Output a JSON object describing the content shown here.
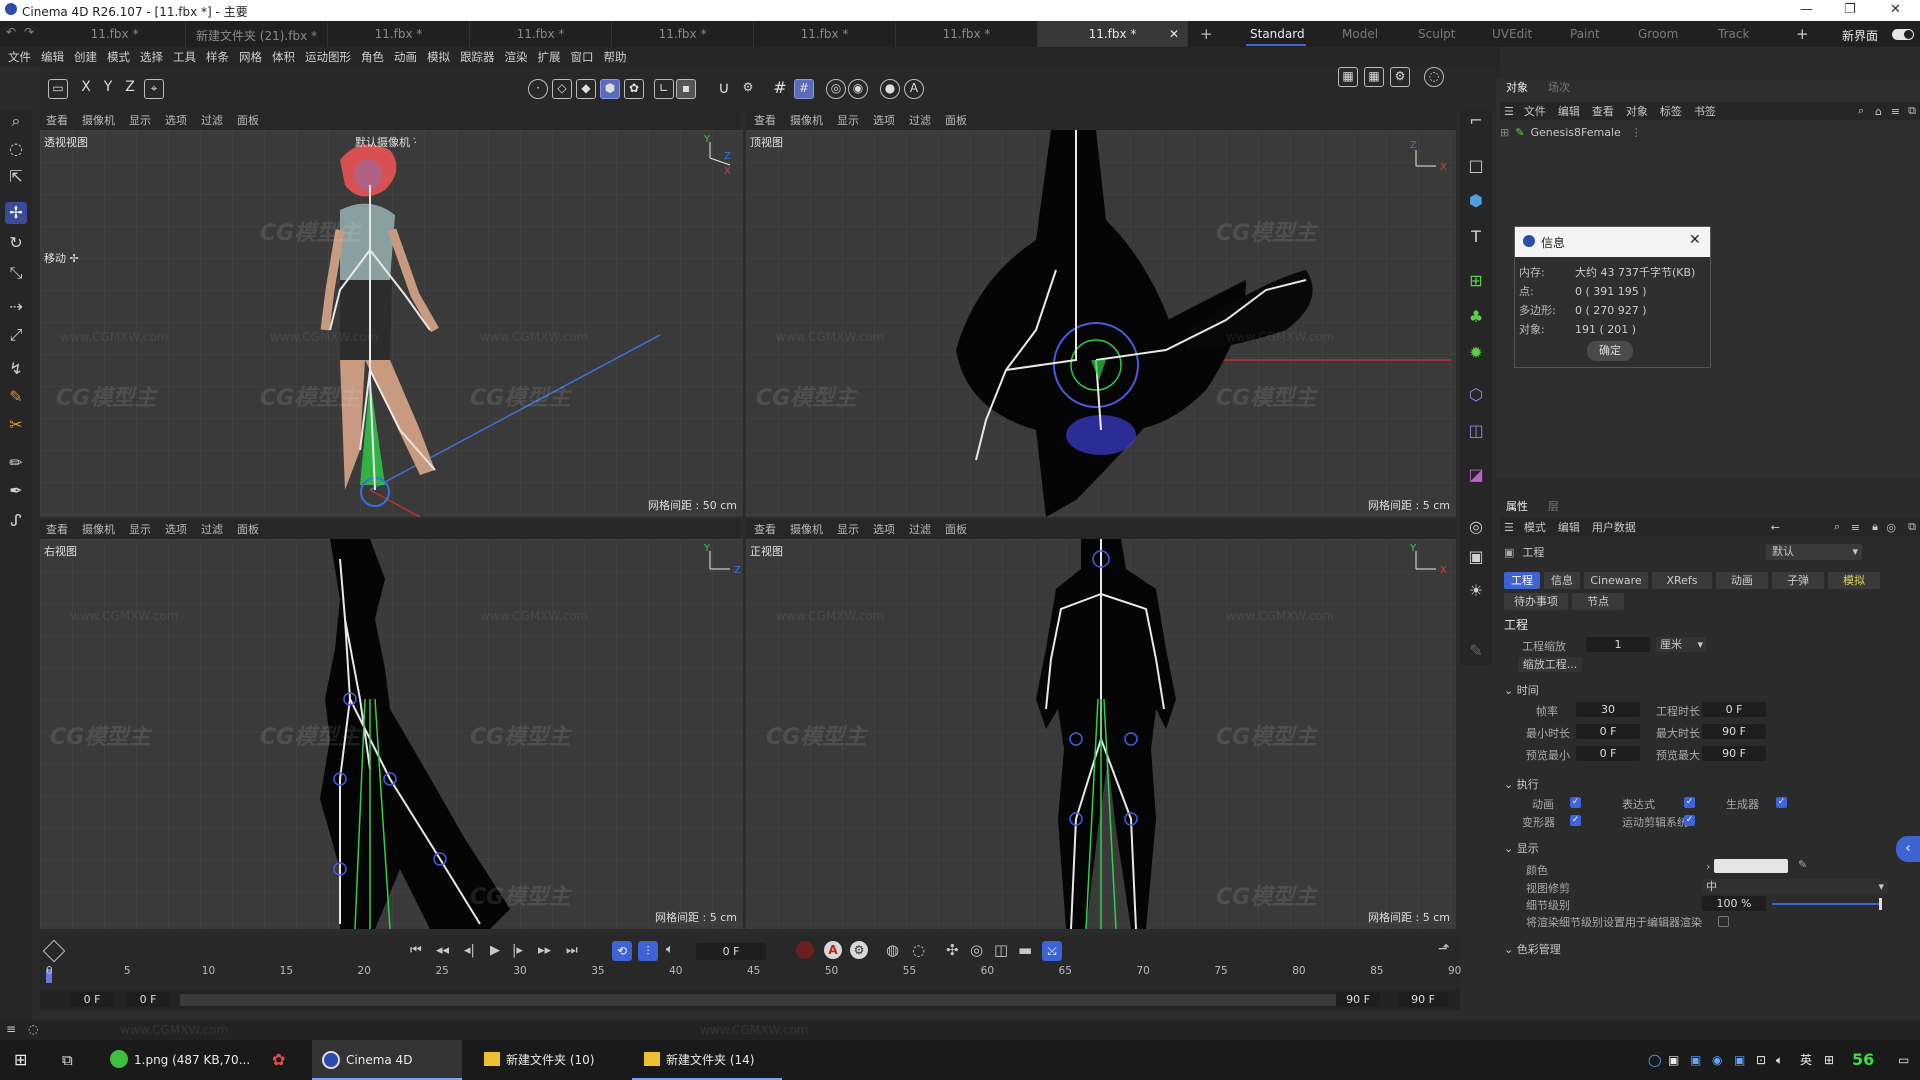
{
  "window": {
    "title": "Cinema 4D R26.107 - [11.fbx *] - 主要"
  },
  "file_tabs": [
    "11.fbx *",
    "新建文件夹 (21).fbx *",
    "11.fbx *",
    "11.fbx *",
    "11.fbx *",
    "11.fbx *",
    "11.fbx *",
    "11.fbx *"
  ],
  "layout_tabs": [
    "Standard",
    "Model",
    "Sculpt",
    "UVEdit",
    "Paint",
    "Groom",
    "Track"
  ],
  "new_layout": "新界面",
  "menu": [
    "文件",
    "编辑",
    "创建",
    "模式",
    "选择",
    "工具",
    "样条",
    "网格",
    "体积",
    "运动图形",
    "角色",
    "动画",
    "模拟",
    "跟踪器",
    "渲染",
    "扩展",
    "窗口",
    "帮助"
  ],
  "toolbar": {
    "x": "X",
    "y": "Y",
    "z": "Z"
  },
  "viewport_menu": [
    "查看",
    "摄像机",
    "显示",
    "选项",
    "过滤",
    "面板"
  ],
  "viewports": {
    "perspective": {
      "label": "透视视图",
      "camera": "默认摄像机 ·̇",
      "grid": "网格间距 : 50 cm",
      "move": "移动 ✢"
    },
    "top": {
      "label": "顶视图",
      "grid": "网格间距 : 5 cm"
    },
    "right": {
      "label": "右视图",
      "grid": "网格间距 : 5 cm"
    },
    "front": {
      "label": "正视图",
      "grid": "网格间距 : 5 cm"
    }
  },
  "watermark": {
    "text": "CG模型主",
    "url": "www.CGMXW.com"
  },
  "object_manager": {
    "tabs": [
      "对象",
      "场次"
    ],
    "menu": [
      "文件",
      "编辑",
      "查看",
      "对象",
      "标签",
      "书签"
    ],
    "object": "Genesis8Female"
  },
  "info_dialog": {
    "title": "信息",
    "rows": [
      {
        "label": "内存:",
        "value": "大约 43 737千字节(KB)"
      },
      {
        "label": "点:",
        "value": "0 ( 391 195 )"
      },
      {
        "label": "多边形:",
        "value": "0 ( 270 927 )"
      },
      {
        "label": "对象:",
        "value": "191 ( 201 )"
      }
    ],
    "ok": "确定"
  },
  "attributes": {
    "tabs": [
      "属性",
      "层"
    ],
    "menu": [
      "模式",
      "编辑",
      "用户数据"
    ],
    "section": "工程",
    "preset": "默认",
    "subtabs": [
      "工程",
      "信息",
      "Cineware",
      "XRefs",
      "动画",
      "子弹",
      "模拟"
    ],
    "subtabs2": [
      "待办事项",
      "节点"
    ],
    "heading": "工程",
    "scale_label": "工程缩放",
    "scale_value": "1",
    "scale_unit": "厘米",
    "scale_btn": "缩放工程...",
    "time_group": "时间",
    "fps_label": "帧率",
    "fps": "30",
    "proj_len_label": "工程时长",
    "proj_len": "0 F",
    "min_label": "最小时长",
    "min": "0 F",
    "max_label": "最大时长",
    "max": "90 F",
    "pmin_label": "预览最小",
    "pmin": "0 F",
    "pmax_label": "预览最大",
    "pmax": "90 F",
    "exec_group": "执行",
    "anim": "动画",
    "expr": "表达式",
    "gen": "生成器",
    "deform": "变形器",
    "motion": "运动剪辑系统",
    "display_group": "显示",
    "color_label": "颜色",
    "clip_label": "视图修剪",
    "clip_value": "中",
    "lod_label": "细节级别",
    "lod_value": "100 %",
    "lod_note": "将渲染细节级别设置用于编辑器渲染",
    "color_mgmt": "色彩管理"
  },
  "timeline": {
    "current": "0 F",
    "ticks": [
      "0",
      "5",
      "10",
      "15",
      "20",
      "25",
      "30",
      "35",
      "40",
      "45",
      "50",
      "55",
      "60",
      "65",
      "70",
      "75",
      "80",
      "85",
      "90"
    ],
    "start": "0 F",
    "start2": "0 F",
    "end": "90 F",
    "end2": "90 F"
  },
  "taskbar": {
    "items": [
      "1.png (487 KB,70...",
      "Cinema 4D R26.1...",
      "新建文件夹 (10)",
      "新建文件夹 (14)"
    ],
    "ime": "英",
    "number": "56"
  },
  "colors": {
    "accent": "#3e63d4",
    "bone": "#e8e8e8",
    "green": "#2fd04a"
  }
}
